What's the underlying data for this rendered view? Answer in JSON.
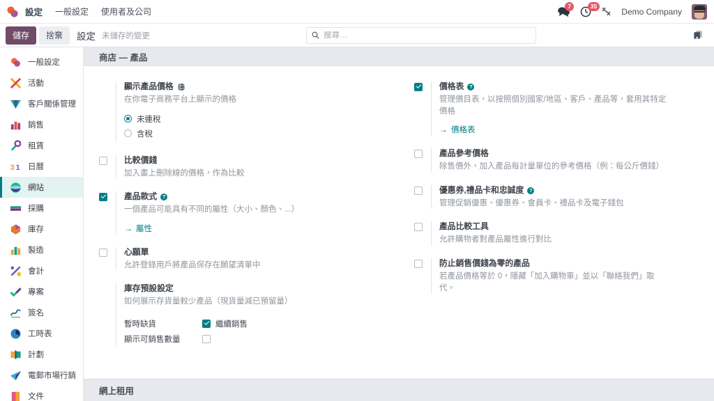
{
  "navbar": {
    "brand_icon": "odoo-logo-icon",
    "app_title": "設定",
    "menu_items": [
      {
        "label": "一般設定",
        "name": "nav-general-settings"
      },
      {
        "label": "使用者及公司",
        "name": "nav-users-companies"
      }
    ],
    "systray": {
      "messages_icon": "chat-bubbles-icon",
      "messages_count": "7",
      "activities_icon": "clock-icon",
      "activities_count": "35",
      "debug_icon": "wrench-icon",
      "company_name": "Demo Company",
      "avatar_icon": "user-avatar-icon"
    }
  },
  "control_panel": {
    "save_label": "儲存",
    "discard_label": "捨棄",
    "breadcrumb": "設定",
    "dirty_label": "未儲存的變更",
    "doc_icon": "book-icon",
    "accent_color": "#714B67"
  },
  "search": {
    "icon": "search-icon",
    "placeholder": "搜尋…",
    "value": ""
  },
  "sidebar": {
    "active_index": 6,
    "items": [
      {
        "label": "一般設定",
        "name": "sidebar-item-general-settings",
        "icon": "settings-app-icon",
        "c1": "#f06a3c",
        "c2": "#b13a86"
      },
      {
        "label": "活動",
        "name": "sidebar-item-discuss",
        "icon": "activity-app-icon",
        "c1": "#f5a623",
        "c2": "#e0414f"
      },
      {
        "label": "客戶關係管理",
        "name": "sidebar-item-crm",
        "icon": "crm-app-icon",
        "c1": "#27b3a0",
        "c2": "#4a3f8f"
      },
      {
        "label": "銷售",
        "name": "sidebar-item-sales",
        "icon": "sales-app-icon",
        "c1": "#e8553a",
        "c2": "#9b3f8c"
      },
      {
        "label": "租賃",
        "name": "sidebar-item-rental",
        "icon": "rental-app-icon",
        "c1": "#17a589",
        "c2": "#8e44ad"
      },
      {
        "label": "日曆",
        "name": "sidebar-item-calendar",
        "icon": "calendar-31-icon",
        "c1": "#e8a33d",
        "c2": "#6c5ce7"
      },
      {
        "label": "網站",
        "name": "sidebar-item-website",
        "icon": "website-app-icon",
        "c1": "#1abc9c",
        "c2": "#2c3e8f"
      },
      {
        "label": "採購",
        "name": "sidebar-item-purchase",
        "icon": "purchase-app-icon",
        "c1": "#7b2d74",
        "c2": "#16a085"
      },
      {
        "label": "庫存",
        "name": "sidebar-item-inventory",
        "icon": "inventory-app-icon",
        "c1": "#e07b39",
        "c2": "#8e44ad"
      },
      {
        "label": "製造",
        "name": "sidebar-item-manufacturing",
        "icon": "manufacturing-app-icon",
        "c1": "#16a085",
        "c2": "#e8a33d"
      },
      {
        "label": "會計",
        "name": "sidebar-item-accounting",
        "icon": "accounting-app-icon",
        "c1": "#7b4fc0",
        "c2": "#f2c12e"
      },
      {
        "label": "專案",
        "name": "sidebar-item-project",
        "icon": "project-check-icon",
        "c1": "#18b49a",
        "c2": "#5b3d9e"
      },
      {
        "label": "簽名",
        "name": "sidebar-item-sign",
        "icon": "sign-pen-icon",
        "c1": "#5bbfa6",
        "c2": "#2f6f8f"
      },
      {
        "label": "工時表",
        "name": "sidebar-item-timesheets",
        "icon": "timesheet-clock-icon",
        "c1": "#2e86c1",
        "c2": "#1b2a63"
      },
      {
        "label": "計劃",
        "name": "sidebar-item-planning",
        "icon": "planning-app-icon",
        "c1": "#f2a33d",
        "c2": "#16a085"
      },
      {
        "label": "電郵市場行銷",
        "name": "sidebar-item-email-marketing",
        "icon": "paper-plane-icon",
        "c1": "#3fa7dd",
        "c2": "#2c3e8f"
      },
      {
        "label": "文件",
        "name": "sidebar-item-documents",
        "icon": "documents-app-icon",
        "c1": "#e05a7a",
        "c2": "#f2a33d"
      }
    ]
  },
  "main": {
    "section_title": "商店 — 產品",
    "next_section_title": "網上租用",
    "left_column": [
      {
        "name": "setting-display-product-prices",
        "has_checkbox": false,
        "title": "顯示產品價格",
        "badge_icon": "globe-icon",
        "help": null,
        "desc": "在你電子商務平台上顯示的價格",
        "radios": [
          {
            "label": "未連稅",
            "checked": true,
            "name": "radio-tax-excluded"
          },
          {
            "label": "含稅",
            "checked": false,
            "name": "radio-tax-included"
          }
        ]
      },
      {
        "name": "setting-compare-price",
        "has_checkbox": true,
        "checked": false,
        "title": "比較價錢",
        "help": null,
        "desc": "加入畫上刪除線的價格，作為比較"
      },
      {
        "name": "setting-product-variants",
        "has_checkbox": true,
        "checked": true,
        "title": "產品款式",
        "help": "?",
        "desc": "一個產品可能具有不同的屬性（大小、顏色、...）",
        "link": {
          "label": "屬性",
          "name": "link-attributes"
        }
      },
      {
        "name": "setting-wishlist",
        "has_checkbox": true,
        "checked": false,
        "title": "心願單",
        "help": null,
        "desc": "允許登錄用戶將產品保存在願望清單中"
      },
      {
        "name": "setting-inventory-defaults",
        "has_checkbox": false,
        "title": "庫存預設設定",
        "help": null,
        "desc": "如何展示存貨量較少產品（現貨量減已預留量）",
        "sub_rows": [
          {
            "label": "暫時缺貨",
            "control": "checkbox",
            "checked": true,
            "control_label": "繼續銷售",
            "name": "row-out-of-stock"
          },
          {
            "label": "顯示可銷售數量",
            "control": "checkbox",
            "checked": false,
            "control_label": "",
            "name": "row-show-available-qty"
          }
        ]
      }
    ],
    "right_column": [
      {
        "name": "setting-pricelists",
        "has_checkbox": true,
        "checked": true,
        "title": "價格表",
        "help": "?",
        "desc": "管理價目表，以按照個別國家/地區、客戶、產品等，套用其特定價格",
        "link": {
          "label": "價格表",
          "name": "link-pricelists"
        }
      },
      {
        "name": "setting-product-reference-price",
        "has_checkbox": true,
        "checked": false,
        "title": "產品參考價格",
        "help": null,
        "desc": "除售價外，加入產品每計量單位的參考價格（例：每公斤價錢）"
      },
      {
        "name": "setting-coupons-giftcards-loyalty",
        "has_checkbox": true,
        "checked": false,
        "title": "優惠券,禮品卡和忠誠度",
        "help": "?",
        "desc": "管理促銷優惠、優惠券、會員卡、禮品卡及電子錢包"
      },
      {
        "name": "setting-product-comparison-tool",
        "has_checkbox": true,
        "checked": false,
        "title": "產品比較工具",
        "help": null,
        "desc": "允許購物者對產品屬性進行對比"
      },
      {
        "name": "setting-prevent-zero-price-sale",
        "has_checkbox": true,
        "checked": false,
        "title": "防止銷售價錢為零的產品",
        "help": null,
        "desc": "若產品價格等於 0，隱藏「加入購物車」並以「聯絡我們」取代。"
      }
    ]
  },
  "colors": {
    "accent_purple": "#714B67",
    "accent_teal": "#017e84",
    "badge_red": "#e6586b",
    "section_bg": "#e7e9ee",
    "active_sidebar_bg": "#e3f3f2"
  }
}
